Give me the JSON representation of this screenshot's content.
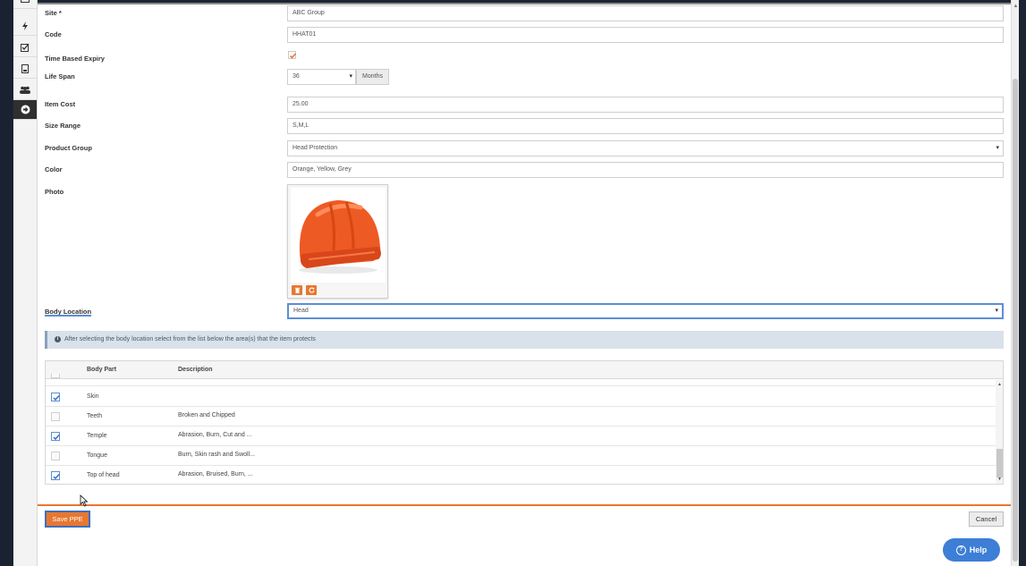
{
  "form": {
    "site": {
      "label": "Site *",
      "value": "ABC Group"
    },
    "code": {
      "label": "Code",
      "value": "HHAT01"
    },
    "time_based_expiry": {
      "label": "Time Based Expiry",
      "checked": true
    },
    "life_span": {
      "label": "Life Span",
      "value": "36",
      "unit": "Months"
    },
    "item_cost": {
      "label": "Item Cost",
      "value": "25.00"
    },
    "size_range": {
      "label": "Size Range",
      "value": "S,M,L"
    },
    "product_group": {
      "label": "Product Group",
      "value": "Head Protection"
    },
    "color": {
      "label": "Color",
      "value": "Orange, Yellow, Grey"
    },
    "photo": {
      "label": "Photo",
      "alt": "orange hard hat"
    },
    "body_location": {
      "label": "Body Location",
      "value": "Head"
    }
  },
  "info": {
    "text": "After selecting the body location select from the list below the area(s) that the item protects"
  },
  "grid": {
    "columns": [
      "Body Part",
      "Description"
    ],
    "rows": [
      {
        "part": "Skin",
        "description": "",
        "checked": true
      },
      {
        "part": "Teeth",
        "description": "Broken and Chipped",
        "checked": false
      },
      {
        "part": "Temple",
        "description": "Abrasion, Burn, Cut and ...",
        "checked": true
      },
      {
        "part": "Tongue",
        "description": "Burn, Skin rash and Swoll...",
        "checked": false
      },
      {
        "part": "Top of head",
        "description": "Abrasion, Bruised, Burn, ...",
        "checked": true
      }
    ]
  },
  "buttons": {
    "save": "Save PPE",
    "cancel": "Cancel",
    "help": "Help"
  },
  "colors": {
    "accent": "#e87730",
    "focus": "#5b8fd8",
    "help": "#3d7ed6"
  },
  "sidebar_icons": [
    "hierarchy-icon",
    "lightning-icon",
    "checklist-icon",
    "document-icon",
    "people-icon",
    "arrow-right-icon"
  ]
}
